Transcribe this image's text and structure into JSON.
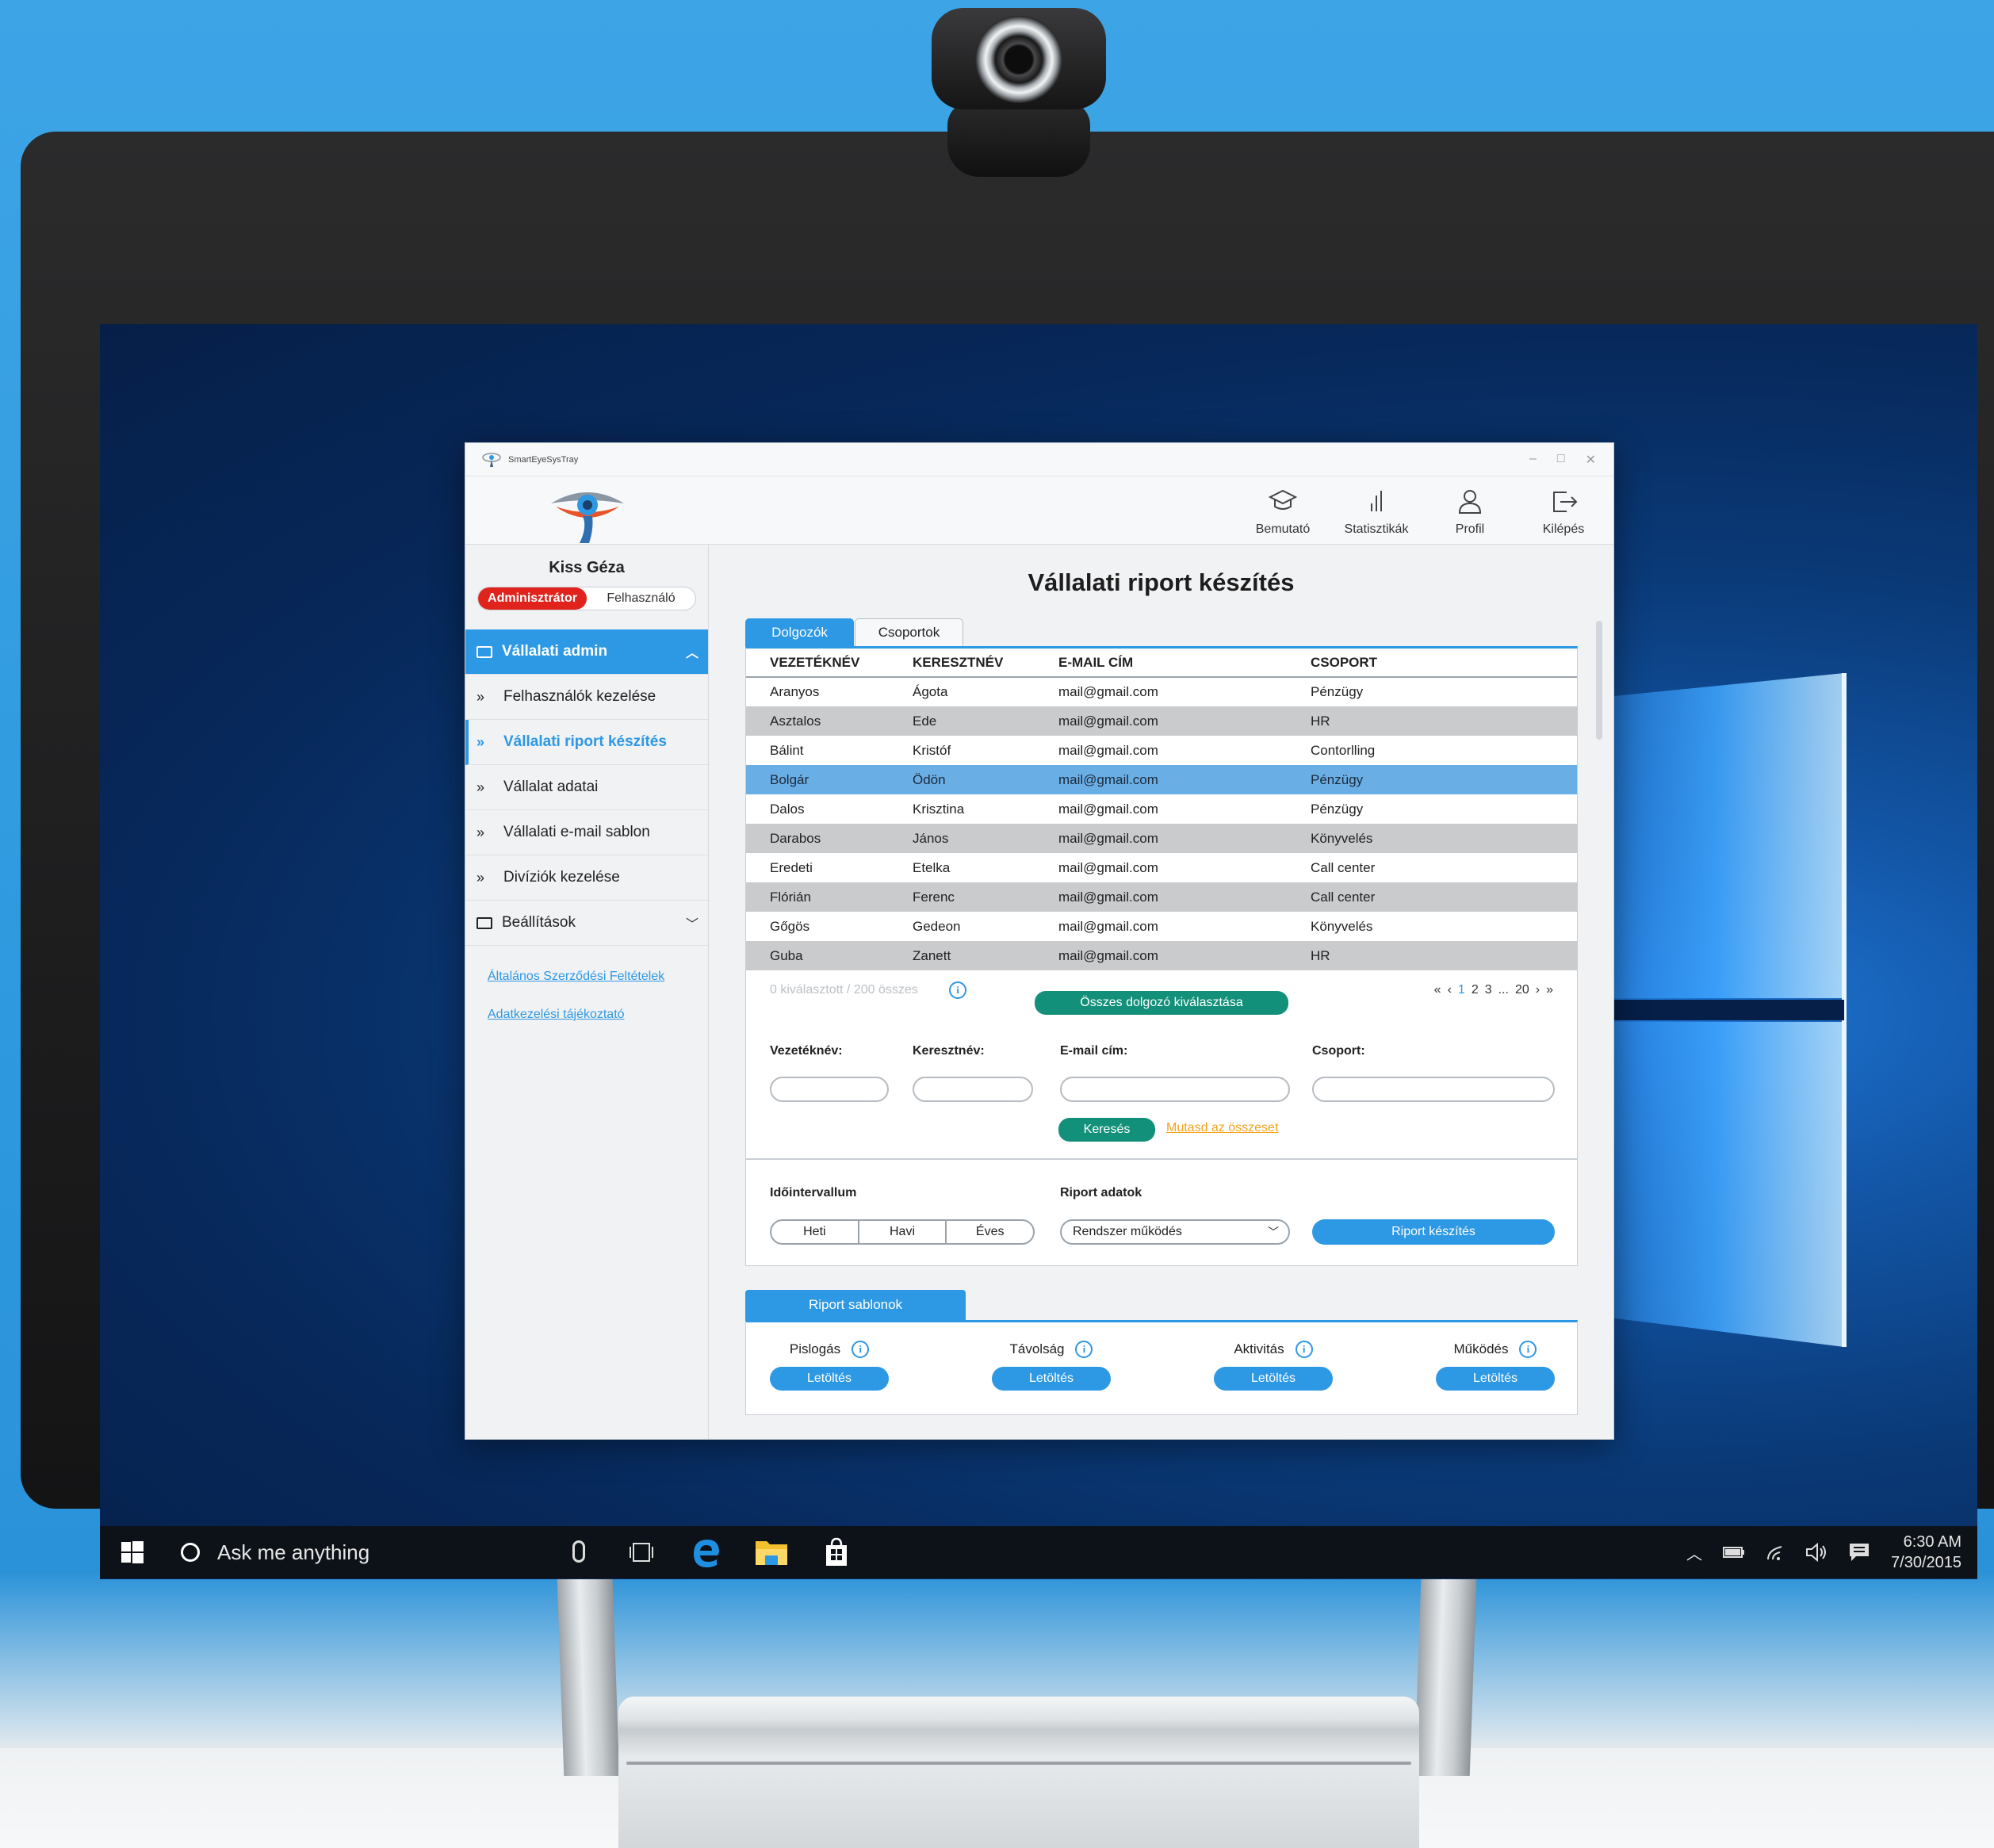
{
  "taskbar": {
    "search_text": "Ask me anything",
    "time": "6:30 AM",
    "date": "7/30/2015"
  },
  "app": {
    "window_title": "SmartEyeSysTray",
    "nav": [
      {
        "label": "Bemutató",
        "icon": "graduation-cap-icon"
      },
      {
        "label": "Statisztikák",
        "icon": "bar-chart-icon"
      },
      {
        "label": "Profil",
        "icon": "user-icon"
      },
      {
        "label": "Kilépés",
        "icon": "logout-icon"
      }
    ],
    "user": {
      "name": "Kiss Géza",
      "role_admin": "Adminisztrátor",
      "role_user": "Felhasználó"
    },
    "sidebar": {
      "group_open": "Vállalati admin",
      "items": [
        "Felhasználók kezelése",
        "Vállalati riport készítés",
        "Vállalat adatai",
        "Vállalati e-mail sablon",
        "Divíziók kezelése"
      ],
      "group_closed": "Beállítások",
      "links": [
        "Általános Szerződési Feltételek",
        "Adatkezelési tájékoztató"
      ]
    },
    "main": {
      "title": "Vállalati riport készítés",
      "tabs": [
        "Dolgozók",
        "Csoportok"
      ],
      "table": {
        "headers": [
          "VEZETÉKNÉV",
          "KERESZTNÉV",
          "E-MAIL CÍM",
          "CSOPORT"
        ],
        "rows": [
          [
            "Aranyos",
            "Ágota",
            "mail@gmail.com",
            "Pénzügy"
          ],
          [
            "Asztalos",
            "Ede",
            "mail@gmail.com",
            "HR"
          ],
          [
            "Bálint",
            "Kristóf",
            "mail@gmail.com",
            "Contorlling"
          ],
          [
            "Bolgár",
            "Ödön",
            "mail@gmail.com",
            "Pénzügy"
          ],
          [
            "Dalos",
            "Krisztina",
            "mail@gmail.com",
            "Pénzügy"
          ],
          [
            "Darabos",
            "János",
            "mail@gmail.com",
            "Könyvelés"
          ],
          [
            "Eredeti",
            "Etelka",
            "mail@gmail.com",
            "Call center"
          ],
          [
            "Flórián",
            "Ferenc",
            "mail@gmail.com",
            "Call center"
          ],
          [
            "Gőgös",
            "Gedeon",
            "mail@gmail.com",
            "Könyvelés"
          ],
          [
            "Guba",
            "Zanett",
            "mail@gmail.com",
            "HR"
          ]
        ]
      },
      "selection_count": "0 kiválasztott / 200 összes",
      "select_all": "Összes dolgozó kiválasztása",
      "pager": {
        "first": "«",
        "prev": "‹",
        "pages": [
          "1",
          "2",
          "3"
        ],
        "ellipsis": "...",
        "last_page": "20",
        "next": "›",
        "last": "»"
      },
      "search": {
        "labels": [
          "Vezetéknév:",
          "Keresztnév:",
          "E-mail cím:",
          "Csoport:"
        ],
        "search_button": "Keresés",
        "show_all": "Mutasd az összeset"
      },
      "report": {
        "interval_label": "Időintervallum",
        "intervals": [
          "Heti",
          "Havi",
          "Éves"
        ],
        "data_label": "Riport adatok",
        "data_selected": "Rendszer működés",
        "create_button": "Riport készítés"
      },
      "templates": {
        "tab_label": "Riport sablonok",
        "items": [
          "Pislogás",
          "Távolság",
          "Aktivitás",
          "Működés"
        ],
        "download_label": "Letöltés"
      }
    }
  },
  "colors": {
    "accent": "#2d98e4",
    "admin_red": "#e0241d",
    "teal": "#12907a",
    "link_orange": "#f2a21b"
  }
}
